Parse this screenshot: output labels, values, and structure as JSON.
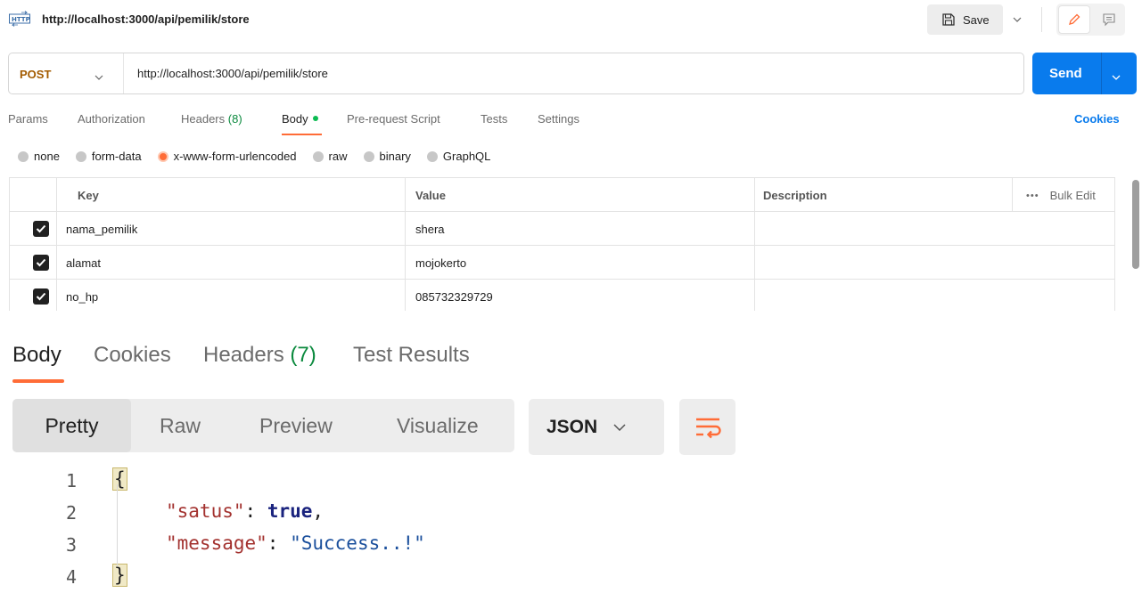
{
  "header": {
    "title": "http://localhost:3000/api/pemilik/store",
    "save_label": "Save"
  },
  "request": {
    "method": "POST",
    "url": "http://localhost:3000/api/pemilik/store",
    "send_label": "Send"
  },
  "request_tabs": [
    {
      "label": "Params"
    },
    {
      "label": "Authorization"
    },
    {
      "label": "Headers",
      "count": "(8)"
    },
    {
      "label": "Body"
    },
    {
      "label": "Pre-request Script"
    },
    {
      "label": "Tests"
    },
    {
      "label": "Settings"
    }
  ],
  "cookies_label": "Cookies",
  "body_types": [
    "none",
    "form-data",
    "x-www-form-urlencoded",
    "raw",
    "binary",
    "GraphQL"
  ],
  "selected_body_type": "x-www-form-urlencoded",
  "params_table": {
    "columns": [
      "Key",
      "Value",
      "Description"
    ],
    "bulk_edit_label": "Bulk Edit",
    "rows": [
      {
        "key": "nama_pemilik",
        "value": "shera",
        "description": "",
        "checked": true
      },
      {
        "key": "alamat",
        "value": "mojokerto",
        "description": "",
        "checked": true
      },
      {
        "key": "no_hp",
        "value": "085732329729",
        "description": "",
        "checked": true
      }
    ]
  },
  "response_tabs": [
    {
      "label": "Body"
    },
    {
      "label": "Cookies"
    },
    {
      "label": "Headers",
      "count": "(7)"
    },
    {
      "label": "Test Results"
    }
  ],
  "formats": [
    "Pretty",
    "Raw",
    "Preview",
    "Visualize"
  ],
  "format_language": "JSON",
  "response_body": {
    "line_numbers": [
      "1",
      "2",
      "3",
      "4"
    ],
    "open_brace": "{",
    "close_brace": "}",
    "entries": [
      {
        "key": "\"satus\"",
        "value": "true",
        "trailing": ","
      },
      {
        "key": "\"message\"",
        "value": "\"Success..!\"",
        "trailing": ""
      }
    ]
  },
  "colors": {
    "accent": "#ff6c37",
    "send": "#097bed",
    "method": "#a35b00",
    "count": "#0b8a3e"
  }
}
